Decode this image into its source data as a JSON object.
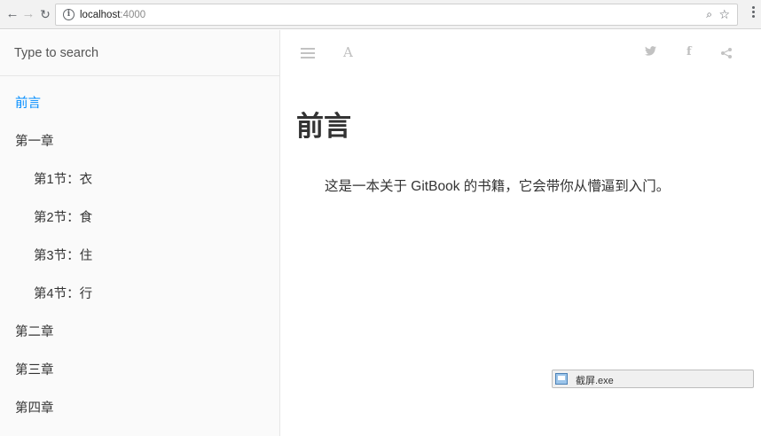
{
  "browser": {
    "host": "localhost",
    "port": ":4000",
    "icons": [
      "back-icon",
      "forward-icon",
      "reload-icon",
      "info-icon",
      "zoom-icon",
      "star-icon",
      "menu-icon"
    ]
  },
  "sidebar": {
    "search_placeholder": "Type to search",
    "items": [
      {
        "label": "前言",
        "active": true
      },
      {
        "label": "第一章"
      },
      {
        "label": "第1节：衣"
      },
      {
        "label": "第2节：食"
      },
      {
        "label": "第3节：住"
      },
      {
        "label": "第4节：行"
      },
      {
        "label": "第二章"
      },
      {
        "label": "第三章"
      },
      {
        "label": "第四章"
      }
    ]
  },
  "toolbar": {
    "font_icon_label": "A",
    "facebook_label": "f"
  },
  "page": {
    "title": "前言",
    "text": "这是一本关于 GitBook 的书籍，它会带你从懵逼到入门。"
  },
  "taskbar": {
    "label": "截屏.exe"
  },
  "colors": {
    "accent": "#008cff",
    "sidebar_bg": "#fafafa",
    "text": "#333333"
  }
}
